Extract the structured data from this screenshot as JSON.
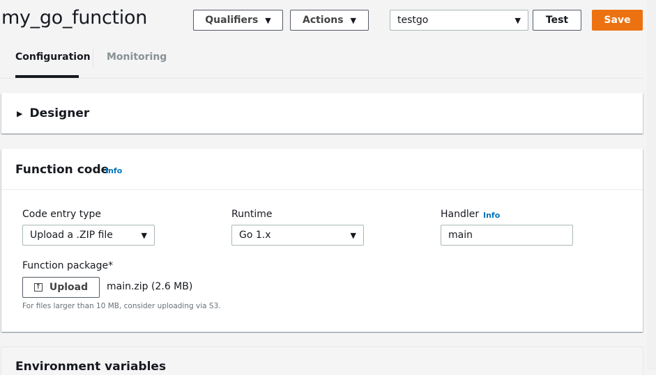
{
  "header": {
    "title": "my_go_function",
    "qualifiers_label": "Qualifiers",
    "actions_label": "Actions",
    "test_event_selected": "testgo",
    "test_label": "Test",
    "save_label": "Save"
  },
  "tabs": [
    {
      "label": "Configuration",
      "active": true
    },
    {
      "label": "Monitoring",
      "active": false
    }
  ],
  "designer": {
    "title": "Designer",
    "icon": "caret-right-icon"
  },
  "function_code": {
    "title": "Function code",
    "info_label": "Info",
    "code_entry_type": {
      "label": "Code entry type",
      "value": "Upload a .ZIP file"
    },
    "runtime": {
      "label": "Runtime",
      "value": "Go 1.x"
    },
    "handler": {
      "label": "Handler",
      "info_label": "Info",
      "value": "main"
    },
    "function_package": {
      "label": "Function package*",
      "upload_label": "Upload",
      "file_name": "main.zip (2.6 MB)",
      "hint": "For files larger than 10 MB, consider uploading via S3."
    }
  },
  "environment_variables": {
    "title": "Environment variables"
  },
  "colors": {
    "primary": "#ec7211",
    "link": "#0073bb",
    "background": "#f4f4f5"
  }
}
